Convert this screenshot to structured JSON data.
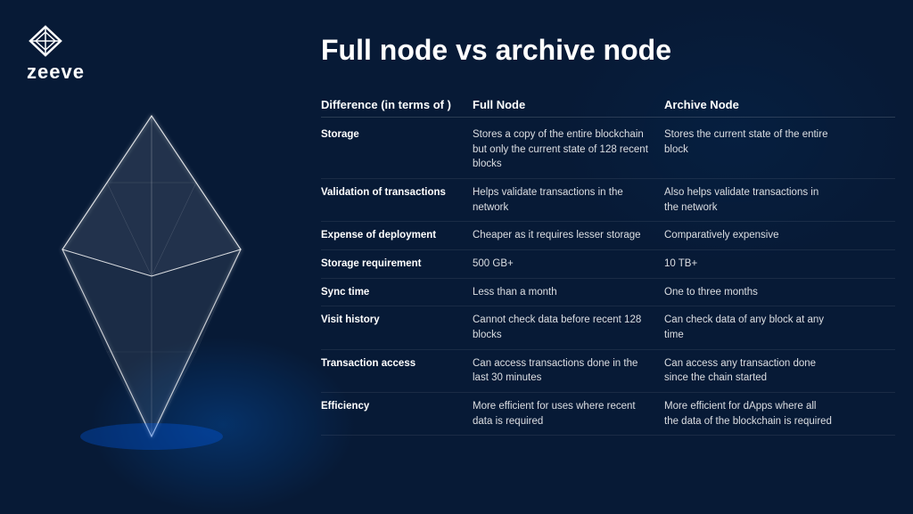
{
  "logo": {
    "text": "zeeve"
  },
  "title": "Full node vs archive node",
  "table": {
    "headers": [
      "Difference (in terms of )",
      "Full Node",
      "Archive Node"
    ],
    "rows": [
      {
        "difference": "Storage",
        "full_node": "Stores a copy of the entire blockchain but only the current state of 128 recent blocks",
        "archive_node": "Stores the current state of the entire block"
      },
      {
        "difference": "Validation of transactions",
        "full_node": "Helps validate transactions in the network",
        "archive_node": "Also helps validate transactions in the network"
      },
      {
        "difference": "Expense of deployment",
        "full_node": "Cheaper as it requires lesser storage",
        "archive_node": "Comparatively expensive"
      },
      {
        "difference": "Storage requirement",
        "full_node": "500 GB+",
        "archive_node": "10 TB+"
      },
      {
        "difference": "Sync time",
        "full_node": "Less than a month",
        "archive_node": "One to three months"
      },
      {
        "difference": "Visit history",
        "full_node": "Cannot check data before recent 128 blocks",
        "archive_node": "Can check data of any block at any time"
      },
      {
        "difference": "Transaction access",
        "full_node": "Can access transactions done in the last 30 minutes",
        "archive_node": "Can access any transaction done since the chain started"
      },
      {
        "difference": "Efficiency",
        "full_node": "More efficient for uses where recent data is required",
        "archive_node": "More efficient for dApps where all the data of the blockchain is required"
      }
    ]
  }
}
